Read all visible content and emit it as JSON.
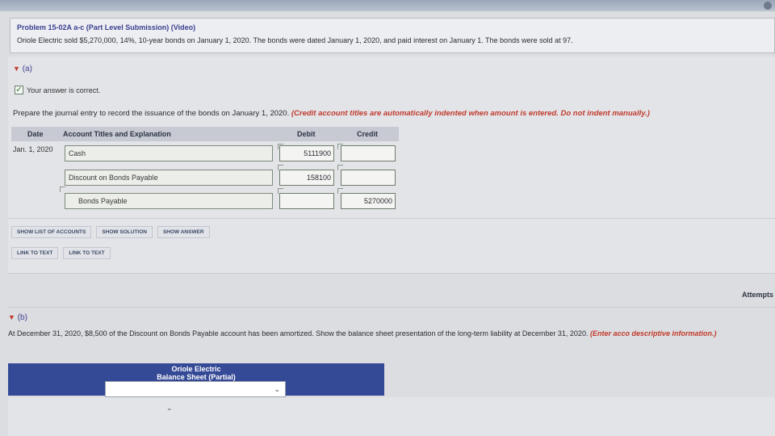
{
  "problem": {
    "title": "Problem 15-02A a-c (Part Level Submission) (Video)",
    "text": "Oriole Electric sold $5,270,000, 14%, 10-year bonds on January 1, 2020. The bonds were dated January 1, 2020, and paid interest on January 1. The bonds were sold at 97."
  },
  "part_a": {
    "label": "(a)",
    "correct_text": "Your answer is correct.",
    "instruction": "Prepare the journal entry to record the issuance of the bonds on January 1, 2020.",
    "instruction_note": "(Credit account titles are automatically indented when amount is entered. Do not indent manually.)",
    "columns": {
      "date": "Date",
      "account": "Account Titles and Explanation",
      "debit": "Debit",
      "credit": "Credit"
    },
    "rows": [
      {
        "date": "Jan. 1, 2020",
        "account": "Cash",
        "debit": "5111900",
        "credit": ""
      },
      {
        "date": "",
        "account": "Discount on Bonds Payable",
        "debit": "158100",
        "credit": ""
      },
      {
        "date": "",
        "account": "Bonds Payable",
        "debit": "",
        "credit": "5270000"
      }
    ],
    "buttons": [
      "SHOW LIST OF ACCOUNTS",
      "SHOW SOLUTION",
      "SHOW ANSWER"
    ],
    "links": [
      "LINK TO TEXT",
      "LINK TO TEXT"
    ]
  },
  "attempts_label": "Attempts",
  "part_b": {
    "label": "(b)",
    "text": "At December 31, 2020, $8,500 of the Discount on Bonds Payable account has been amortized. Show the balance sheet presentation of the long-term liability at December 31, 2020.",
    "note": "(Enter acco descriptive information.)",
    "bs_title_1": "Oriole Electric",
    "bs_title_2": "Balance Sheet (Partial)"
  },
  "icons": [
    "gear-icon",
    "caret-down-icon",
    "check-icon",
    "chevron-down-icon"
  ]
}
